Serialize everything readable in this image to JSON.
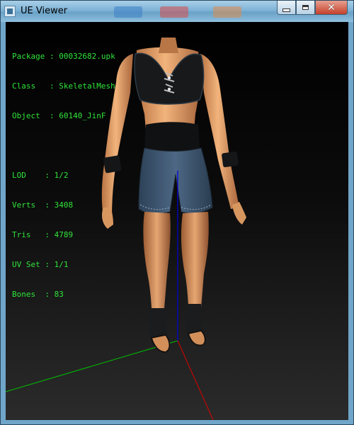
{
  "window": {
    "title": "UE Viewer"
  },
  "info": {
    "asset": [
      {
        "key": "Package",
        "sep": " : ",
        "value": "00032682.upk"
      },
      {
        "key": "Class  ",
        "sep": " : ",
        "value": "SkeletalMesh"
      },
      {
        "key": "Object ",
        "sep": " : ",
        "value": "60140_JinF"
      }
    ],
    "stats": [
      {
        "key": "LOD    ",
        "sep": ": ",
        "value": "1/2"
      },
      {
        "key": "Verts  ",
        "sep": ": ",
        "value": "3408"
      },
      {
        "key": "Tris   ",
        "sep": ": ",
        "value": "4789"
      },
      {
        "key": "UV Set ",
        "sep": ": ",
        "value": "1/1"
      },
      {
        "key": "Bones  ",
        "sep": ": ",
        "value": "83"
      }
    ]
  },
  "colors": {
    "info_text": "#2fe33a",
    "axis_x": "#e00000",
    "axis_y": "#00c000",
    "axis_z": "#0000e0",
    "skin": "#e2a26e",
    "outfit_dark": "#16181a",
    "shorts": "#3e5670"
  },
  "icons": {
    "app": "app-icon",
    "minimize": "minimize-icon",
    "maximize": "maximize-icon",
    "close": "close-icon"
  }
}
